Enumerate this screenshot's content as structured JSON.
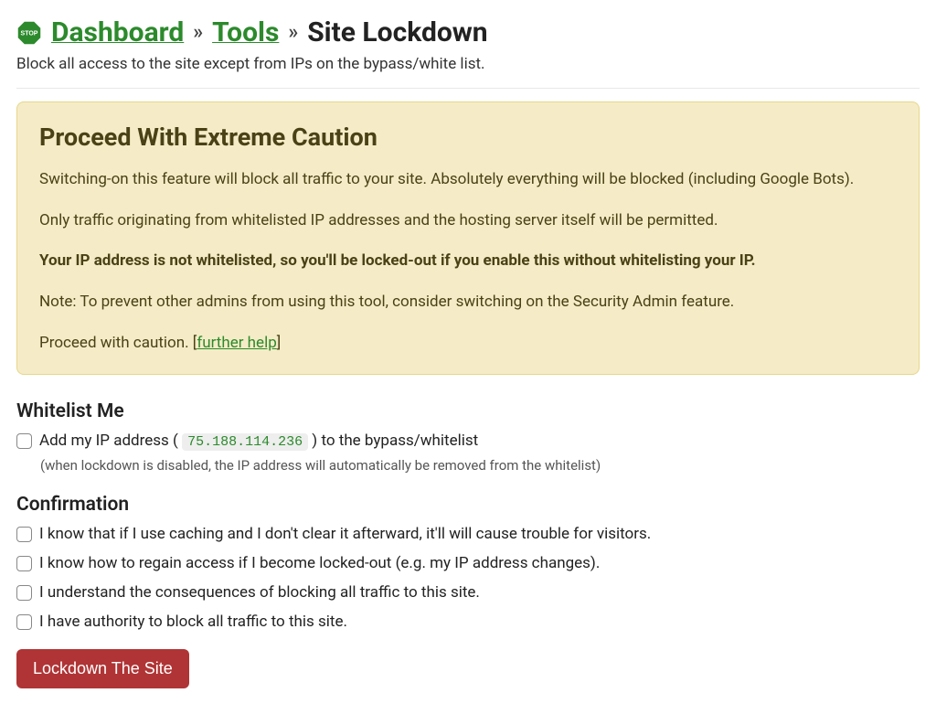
{
  "breadcrumb": {
    "dashboard": "Dashboard",
    "tools": "Tools",
    "current": "Site Lockdown",
    "separator": "»"
  },
  "subheading": "Block all access to the site except from IPs on the bypass/white list.",
  "warning": {
    "title": "Proceed With Extreme Caution",
    "p1": "Switching-on this feature will block all traffic to your site. Absolutely everything will be blocked (including Google Bots).",
    "p2": "Only traffic originating from whitelisted IP addresses and the hosting server itself will be permitted.",
    "p3": "Your IP address is not whitelisted, so you'll be locked-out if you enable this without whitelisting your IP.",
    "p4": "Note: To prevent other admins from using this tool, consider switching on the Security Admin feature.",
    "p5_prefix": "Proceed with caution. [",
    "p5_link": "further help",
    "p5_suffix": "]"
  },
  "whitelist": {
    "heading": "Whitelist Me",
    "label_prefix": "Add my IP address ( ",
    "ip": "75.188.114.236",
    "label_suffix": " ) to the bypass/whitelist",
    "note": "(when lockdown is disabled, the IP address will automatically be removed from the whitelist)"
  },
  "confirmation": {
    "heading": "Confirmation",
    "items": [
      "I know that if I use caching and I don't clear it afterward, it'll will cause trouble for visitors.",
      "I know how to regain access if I become locked-out (e.g. my IP address changes).",
      "I understand the consequences of blocking all traffic to this site.",
      "I have authority to block all traffic to this site."
    ]
  },
  "button": {
    "lockdown": "Lockdown The Site"
  }
}
